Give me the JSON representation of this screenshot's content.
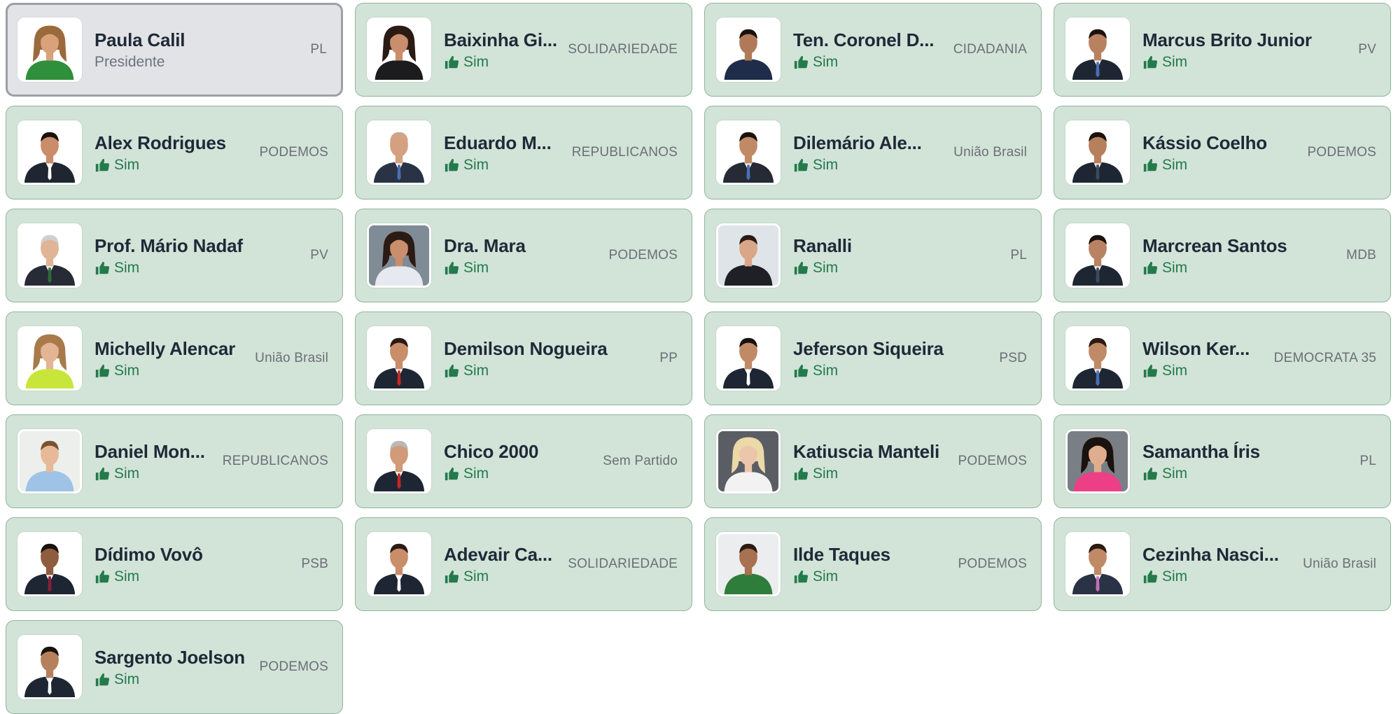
{
  "colors": {
    "card_bg": "#d2e3d8",
    "card_border": "#8fb59b",
    "president_bg": "#e2e3e6",
    "president_border": "#9c9fa6",
    "vote_yes": "#237a4b"
  },
  "icons": {
    "vote": "thumbs-up-icon"
  },
  "members": [
    {
      "name": "Paula Calil",
      "party": "PL",
      "role": "Presidente",
      "vote": "",
      "photo": {
        "bg": "#ffffff",
        "skin": "#d9a27b",
        "hair": "#9b6a3c",
        "outfit": "#2f8f3a",
        "accent": "#2f8f3a",
        "style": "woman"
      }
    },
    {
      "name": "Baixinha Gi...",
      "party": "SOLIDARIEDADE",
      "role": "",
      "vote": "Sim",
      "photo": {
        "bg": "#ffffff",
        "skin": "#c98e6c",
        "hair": "#2b1b14",
        "outfit": "#1c1c1f",
        "accent": "#ffffff",
        "style": "woman"
      }
    },
    {
      "name": "Ten. Coronel D...",
      "party": "CIDADANIA",
      "role": "",
      "vote": "Sim",
      "photo": {
        "bg": "#ffffff",
        "skin": "#b07a58",
        "hair": "#1a120e",
        "outfit": "#1f2d4a",
        "accent": "#1f2d4a",
        "style": "man"
      }
    },
    {
      "name": "Marcus Brito Junior",
      "party": "PV",
      "role": "",
      "vote": "Sim",
      "photo": {
        "bg": "#ffffff",
        "skin": "#b88160",
        "hair": "#1a120e",
        "outfit": "#1f2633",
        "accent": "#4a6fb5",
        "style": "suit"
      }
    },
    {
      "name": "Alex Rodrigues",
      "party": "PODEMOS",
      "role": "",
      "vote": "Sim",
      "photo": {
        "bg": "#ffffff",
        "skin": "#c98d6a",
        "hair": "#1a120e",
        "outfit": "#202631",
        "accent": "#ffffff",
        "style": "suit"
      }
    },
    {
      "name": "Eduardo M...",
      "party": "REPUBLICANOS",
      "role": "",
      "vote": "Sim",
      "photo": {
        "bg": "#ffffff",
        "skin": "#d4a07f",
        "hair": "#cfa58a",
        "outfit": "#2a3345",
        "accent": "#4a6fb5",
        "style": "suit"
      }
    },
    {
      "name": "Dilemário Ale...",
      "party": "União Brasil",
      "role": "",
      "vote": "Sim",
      "photo": {
        "bg": "#ffffff",
        "skin": "#c08a66",
        "hair": "#1a120e",
        "outfit": "#252a35",
        "accent": "#4a6fb5",
        "style": "suit"
      }
    },
    {
      "name": "Kássio Coelho",
      "party": "PODEMOS",
      "role": "",
      "vote": "Sim",
      "photo": {
        "bg": "#ffffff",
        "skin": "#b7805c",
        "hair": "#1a120e",
        "outfit": "#1f2633",
        "accent": "#3b4a5e",
        "style": "suit"
      }
    },
    {
      "name": "Prof. Mário Nadaf",
      "party": "PV",
      "role": "",
      "vote": "Sim",
      "photo": {
        "bg": "#ffffff",
        "skin": "#e0b497",
        "hair": "#cfcfcf",
        "outfit": "#262b35",
        "accent": "#2f6b3a",
        "style": "suit"
      }
    },
    {
      "name": "Dra. Mara",
      "party": "PODEMOS",
      "role": "",
      "vote": "Sim",
      "photo": {
        "bg": "#7f8b95",
        "skin": "#c98e6c",
        "hair": "#2b1b14",
        "outfit": "#e6e9ef",
        "accent": "#e6e9ef",
        "style": "woman"
      }
    },
    {
      "name": "Ranalli",
      "party": "PL",
      "role": "",
      "vote": "Sim",
      "photo": {
        "bg": "#dfe4e8",
        "skin": "#d9a688",
        "hair": "#2b1b14",
        "outfit": "#1f2025",
        "accent": "#1f2025",
        "style": "man"
      }
    },
    {
      "name": "Marcrean Santos",
      "party": "MDB",
      "role": "",
      "vote": "Sim",
      "photo": {
        "bg": "#ffffff",
        "skin": "#b98262",
        "hair": "#1a120e",
        "outfit": "#1f2633",
        "accent": "#3b4a5e",
        "style": "suit"
      }
    },
    {
      "name": "Michelly Alencar",
      "party": "União Brasil",
      "role": "",
      "vote": "Sim",
      "photo": {
        "bg": "#ffffff",
        "skin": "#e3b594",
        "hair": "#a87a4a",
        "outfit": "#c8e63a",
        "accent": "#c8e63a",
        "style": "woman"
      }
    },
    {
      "name": "Demilson Nogueira",
      "party": "PP",
      "role": "",
      "vote": "Sim",
      "photo": {
        "bg": "#ffffff",
        "skin": "#c98d6a",
        "hair": "#2b1b14",
        "outfit": "#1f2633",
        "accent": "#c62828",
        "style": "suit"
      }
    },
    {
      "name": "Jeferson Siqueira",
      "party": "PSD",
      "role": "",
      "vote": "Sim",
      "photo": {
        "bg": "#ffffff",
        "skin": "#c08a66",
        "hair": "#1a120e",
        "outfit": "#1f2633",
        "accent": "#ffffff",
        "style": "suit"
      }
    },
    {
      "name": "Wilson Ker...",
      "party": "DEMOCRATA 35",
      "role": "",
      "vote": "Sim",
      "photo": {
        "bg": "#ffffff",
        "skin": "#c08a66",
        "hair": "#2b1b14",
        "outfit": "#1f2633",
        "accent": "#4a6fb5",
        "style": "suit"
      }
    },
    {
      "name": "Daniel Mon...",
      "party": "REPUBLICANOS",
      "role": "",
      "vote": "Sim",
      "photo": {
        "bg": "#ecefeb",
        "skin": "#e6b999",
        "hair": "#7a5230",
        "outfit": "#9ec3e6",
        "accent": "#9ec3e6",
        "style": "man"
      }
    },
    {
      "name": "Chico 2000",
      "party": "Sem Partido",
      "role": "",
      "vote": "Sim",
      "photo": {
        "bg": "#ffffff",
        "skin": "#d19a78",
        "hair": "#b9b9b9",
        "outfit": "#1f2633",
        "accent": "#c62828",
        "style": "suit"
      }
    },
    {
      "name": "Katiuscia Manteli",
      "party": "PODEMOS",
      "role": "",
      "vote": "Sim",
      "photo": {
        "bg": "#5a5e64",
        "skin": "#ecc6aa",
        "hair": "#ecd9a8",
        "outfit": "#f2f2f2",
        "accent": "#f2f2f2",
        "style": "woman"
      }
    },
    {
      "name": "Samantha Íris",
      "party": "PL",
      "role": "",
      "vote": "Sim",
      "photo": {
        "bg": "#7a7f86",
        "skin": "#e0ae8e",
        "hair": "#1a120e",
        "outfit": "#ec3f86",
        "accent": "#ec3f86",
        "style": "woman"
      }
    },
    {
      "name": "Dídimo Vovô",
      "party": "PSB",
      "role": "",
      "vote": "Sim",
      "photo": {
        "bg": "#ffffff",
        "skin": "#8e5c3f",
        "hair": "#1a120e",
        "outfit": "#1f2633",
        "accent": "#8a1f3b",
        "style": "suit"
      }
    },
    {
      "name": "Adevair Ca...",
      "party": "SOLIDARIEDADE",
      "role": "",
      "vote": "Sim",
      "photo": {
        "bg": "#ffffff",
        "skin": "#c98d6a",
        "hair": "#2b1b14",
        "outfit": "#1f2633",
        "accent": "#ffffff",
        "style": "suit"
      }
    },
    {
      "name": "Ilde Taques",
      "party": "PODEMOS",
      "role": "",
      "vote": "Sim",
      "photo": {
        "bg": "#ecedee",
        "skin": "#a8714f",
        "hair": "#2b1b14",
        "outfit": "#2e7d3a",
        "accent": "#2e7d3a",
        "style": "man"
      }
    },
    {
      "name": "Cezinha Nasci...",
      "party": "União Brasil",
      "role": "",
      "vote": "Sim",
      "photo": {
        "bg": "#ffffff",
        "skin": "#c08a66",
        "hair": "#2b1b14",
        "outfit": "#2a3345",
        "accent": "#c36fb5",
        "style": "suit"
      }
    },
    {
      "name": "Sargento Joelson",
      "party": "PODEMOS",
      "role": "",
      "vote": "Sim",
      "photo": {
        "bg": "#ffffff",
        "skin": "#b7805c",
        "hair": "#1a120e",
        "outfit": "#1f2633",
        "accent": "#ffffff",
        "style": "suit"
      }
    }
  ]
}
